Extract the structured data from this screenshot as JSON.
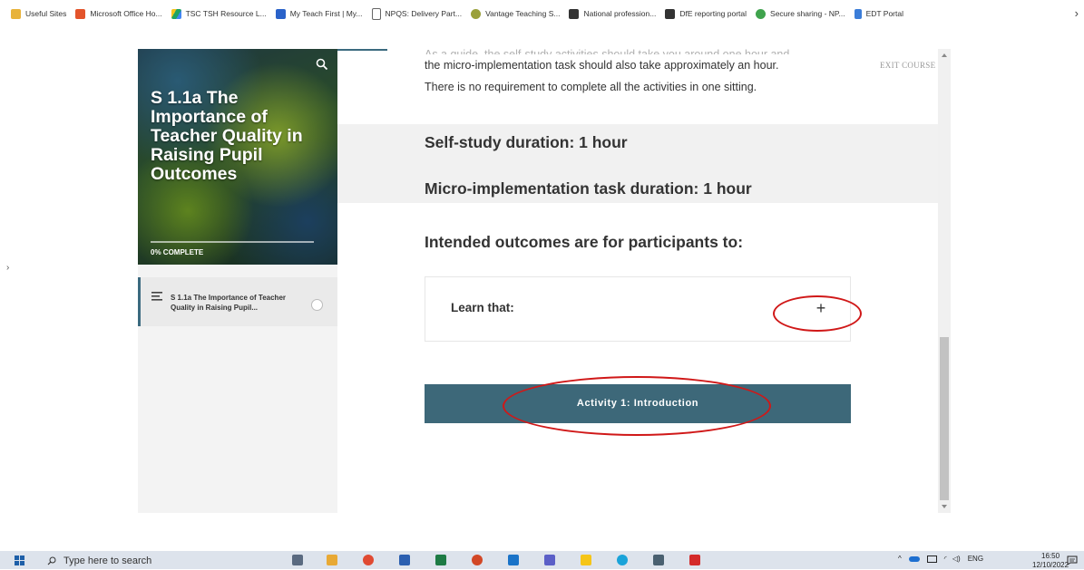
{
  "bookmarks": [
    {
      "label": "Useful Sites",
      "icon": "folder-icon",
      "color": "#e8b33a"
    },
    {
      "label": "Microsoft Office Ho...",
      "icon": "office-icon",
      "color": "#e3542b"
    },
    {
      "label": "TSC TSH Resource L...",
      "icon": "drive-icon",
      "color": "#1fa463"
    },
    {
      "label": "My Teach First | My...",
      "icon": "teach-first-icon",
      "color": "#2a62c9"
    },
    {
      "label": "NPQS: Delivery Part...",
      "icon": "page-icon",
      "color": "#666666"
    },
    {
      "label": "Vantage Teaching S...",
      "icon": "vantage-icon",
      "color": "#9aa03a"
    },
    {
      "label": "National profession...",
      "icon": "dfe-icon",
      "color": "#333333"
    },
    {
      "label": "DfE reporting portal",
      "icon": "dfe-icon",
      "color": "#333333"
    },
    {
      "label": "Secure sharing - NP...",
      "icon": "secure-share-icon",
      "color": "#3fa34d"
    },
    {
      "label": "EDT Portal",
      "icon": "edt-icon",
      "color": "#3b7dd8"
    }
  ],
  "sidebar": {
    "course_title": "S 1.1a The Importance of Teacher Quality in Raising Pupil Outcomes",
    "progress_text": "0% COMPLETE",
    "lesson_label": "S 1.1a The Importance of Teacher Quality in Raising Pupil..."
  },
  "main": {
    "intro_faded": "As a guide, the self-study activities should take you around one hour and",
    "intro_line_1": "the micro-implementation task should also take approximately an hour.",
    "intro_line_2": "There is no requirement to complete all the activities in one sitting.",
    "exit_label": "EXIT COURSE",
    "self_study": "Self-study duration: 1 hour",
    "micro_task": "Micro-implementation task duration: 1 hour",
    "outcomes_heading": "Intended outcomes are for participants to:",
    "accordion_title": "Learn that:",
    "accordion_toggle": "+",
    "activity_button": "Activity 1: Introduction"
  },
  "taskbar": {
    "search_placeholder": "Type here to search",
    "language": "ENG",
    "time": "16:50",
    "date": "12/10/2022"
  },
  "colors": {
    "accent": "#3d6879",
    "annotation_ring": "#d01818"
  }
}
